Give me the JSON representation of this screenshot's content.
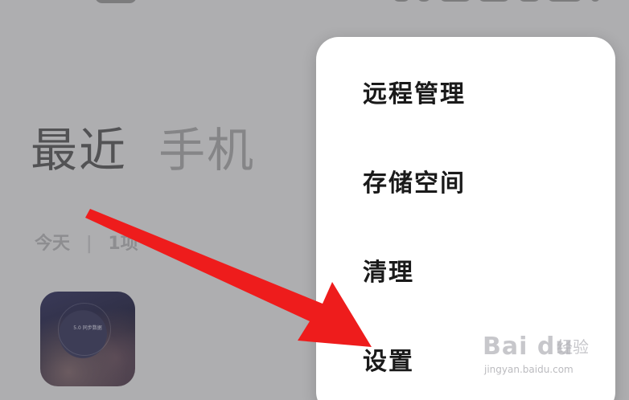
{
  "tabs": [
    {
      "label": "最近"
    },
    {
      "label": "手机"
    }
  ],
  "recent": {
    "date_label": "今天",
    "separator": "|",
    "count_label": "1项",
    "thumb_caption": "5.0 同步数据"
  },
  "menu": {
    "items": [
      {
        "label": "远程管理"
      },
      {
        "label": "存储空间"
      },
      {
        "label": "清理"
      },
      {
        "label": "设置"
      }
    ]
  },
  "watermark": {
    "logo": "Bai du",
    "cn": "经验",
    "url": "jingyan.baidu.com"
  },
  "colors": {
    "dim_background": "#aeaeb0",
    "menu_background": "#ffffff",
    "arrow": "#ee1c1c"
  }
}
